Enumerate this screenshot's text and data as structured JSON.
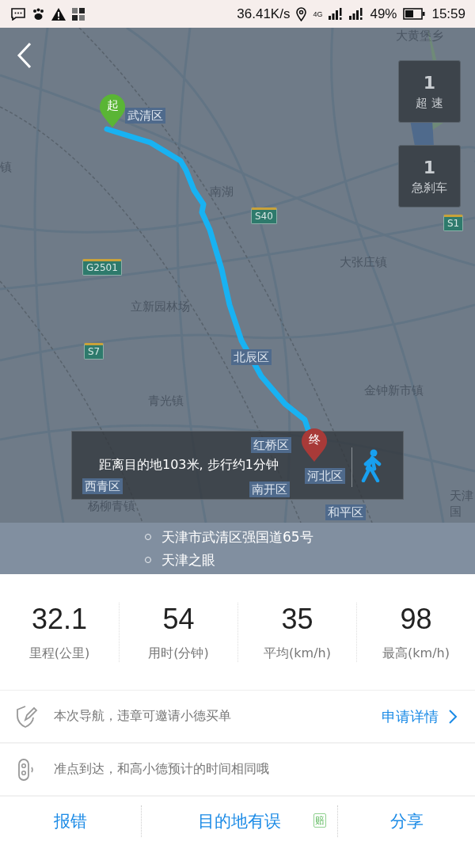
{
  "status_bar": {
    "net_speed": "36.41K/s",
    "network": "4G",
    "battery": "49%",
    "time": "15:59"
  },
  "map": {
    "labels": [
      {
        "text": "大黄堡乡",
        "kind": "town"
      },
      {
        "text": "武清区",
        "kind": "district"
      },
      {
        "text": "镇",
        "kind": "town"
      },
      {
        "text": "南湖",
        "kind": "town"
      },
      {
        "text": "S40",
        "kind": "shield"
      },
      {
        "text": "S1",
        "kind": "shield"
      },
      {
        "text": "G2501",
        "kind": "shield"
      },
      {
        "text": "大张庄镇",
        "kind": "town"
      },
      {
        "text": "立新园林场",
        "kind": "town"
      },
      {
        "text": "S7",
        "kind": "shield"
      },
      {
        "text": "北辰区",
        "kind": "district"
      },
      {
        "text": "青光镇",
        "kind": "town"
      },
      {
        "text": "金钟新市镇",
        "kind": "town"
      },
      {
        "text": "红桥区",
        "kind": "district"
      },
      {
        "text": "河北区",
        "kind": "district"
      },
      {
        "text": "西青区",
        "kind": "district"
      },
      {
        "text": "南开区",
        "kind": "district"
      },
      {
        "text": "杨柳青镇",
        "kind": "town"
      },
      {
        "text": "和平区",
        "kind": "district"
      },
      {
        "text": "天津",
        "kind": "town"
      },
      {
        "text": "国",
        "kind": "town"
      }
    ],
    "start_marker": "起",
    "end_marker": "终",
    "events": [
      {
        "count": "1",
        "label": "超 速"
      },
      {
        "count": "1",
        "label": "急刹车"
      }
    ],
    "banner": "距离目的地103米, 步行约1分钟"
  },
  "addresses": [
    "天津市武清区强国道65号",
    "天津之眼"
  ],
  "stats": [
    {
      "value": "32.1",
      "label": "里程(公里)"
    },
    {
      "value": "54",
      "label": "用时(分钟)"
    },
    {
      "value": "35",
      "label": "平均(km/h)"
    },
    {
      "value": "98",
      "label": "最高(km/h)"
    }
  ],
  "notices": [
    {
      "kind": "shield",
      "text": "本次导航，违章可邀请小德买单",
      "link": "申请详情"
    },
    {
      "kind": "device",
      "text": "准点到达，和高小德预计的时间相同哦"
    }
  ],
  "actions": [
    {
      "label": "报错"
    },
    {
      "label": "目的地有误",
      "badge": "赔"
    },
    {
      "label": "分享"
    }
  ]
}
